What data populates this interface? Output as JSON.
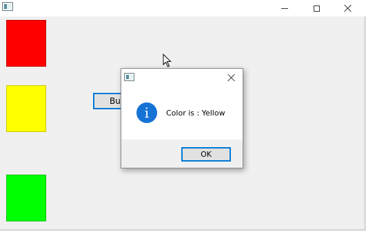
{
  "window": {
    "title": "",
    "controls": [
      "minimize",
      "maximize",
      "close"
    ]
  },
  "main": {
    "button_label": "Button",
    "swatches": [
      {
        "name": "red",
        "color": "#ff0000"
      },
      {
        "name": "yellow",
        "color": "#ffff00"
      },
      {
        "name": "green",
        "color": "#00ff00"
      }
    ]
  },
  "dialog": {
    "title": "",
    "icon": "info-icon",
    "icon_glyph": "i",
    "message": "Color is : Yellow",
    "ok_label": "OK"
  },
  "colors": {
    "accent": "#0078d7",
    "info": "#1673d6"
  }
}
